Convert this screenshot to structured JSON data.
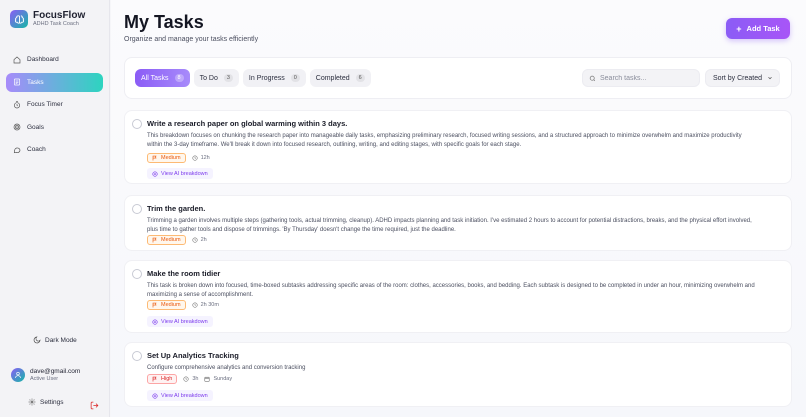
{
  "app": {
    "name": "FocusFlow",
    "tagline": "ADHD Task Coach"
  },
  "sidebar": {
    "items": [
      {
        "label": "Dashboard",
        "icon": "home-icon"
      },
      {
        "label": "Tasks",
        "icon": "tasks-icon",
        "active": true
      },
      {
        "label": "Focus Timer",
        "icon": "timer-icon"
      },
      {
        "label": "Goals",
        "icon": "target-icon"
      },
      {
        "label": "Coach",
        "icon": "chat-icon"
      }
    ],
    "dark_mode_label": "Dark Mode",
    "user": {
      "email": "dave@gmail.com",
      "status": "Active User"
    },
    "settings_label": "Settings"
  },
  "header": {
    "title": "My Tasks",
    "subtitle": "Organize and manage your tasks efficiently",
    "add_button_label": "Add Task"
  },
  "filters": {
    "tabs": [
      {
        "label": "All Tasks",
        "count": "8"
      },
      {
        "label": "To Do",
        "count": "3"
      },
      {
        "label": "In Progress",
        "count": "0"
      },
      {
        "label": "Completed",
        "count": "6"
      }
    ],
    "search_placeholder": "Search tasks...",
    "sort_label": "Sort by Created"
  },
  "tasks": [
    {
      "title": "Write a research paper on global warming within 3 days.",
      "description": "This breakdown focuses on chunking the research paper into manageable daily tasks, emphasizing preliminary research, focused writing sessions, and a structured approach to minimize overwhelm and maximize productivity within the 3-day timeframe. We'll break it down into focused research, outlining, writing, and editing stages, with specific goals for each stage.",
      "priority": "Medium",
      "time": "12h",
      "ai_label": "View AI breakdown"
    },
    {
      "title": "Trim the garden.",
      "description": "Trimming a garden involves multiple steps (gathering tools, actual trimming, cleanup). ADHD impacts planning and task initiation. I've estimated 2 hours to account for potential distractions, breaks, and the physical effort involved, plus time to gather tools and dispose of trimmings. 'By Thursday' doesn't change the time required, just the deadline.",
      "priority": "Medium",
      "time": "2h"
    },
    {
      "title": "Make the room tidier",
      "description": "This task is broken down into focused, time-boxed subtasks addressing specific areas of the room: clothes, accessories, books, and bedding. Each subtask is designed to be completed in under an hour, minimizing overwhelm and maximizing a sense of accomplishment.",
      "priority": "Medium",
      "time": "2h 30m",
      "ai_label": "View AI breakdown"
    },
    {
      "title": "Set Up Analytics Tracking",
      "description": "Configure comprehensive analytics and conversion tracking",
      "priority": "High",
      "time": "3h",
      "due": "Sunday",
      "ai_label": "View AI breakdown"
    }
  ],
  "colors": {
    "accent": "#8b5cf6",
    "teal": "#2dd4bf",
    "medium": "#ea580c",
    "high": "#dc2626"
  }
}
